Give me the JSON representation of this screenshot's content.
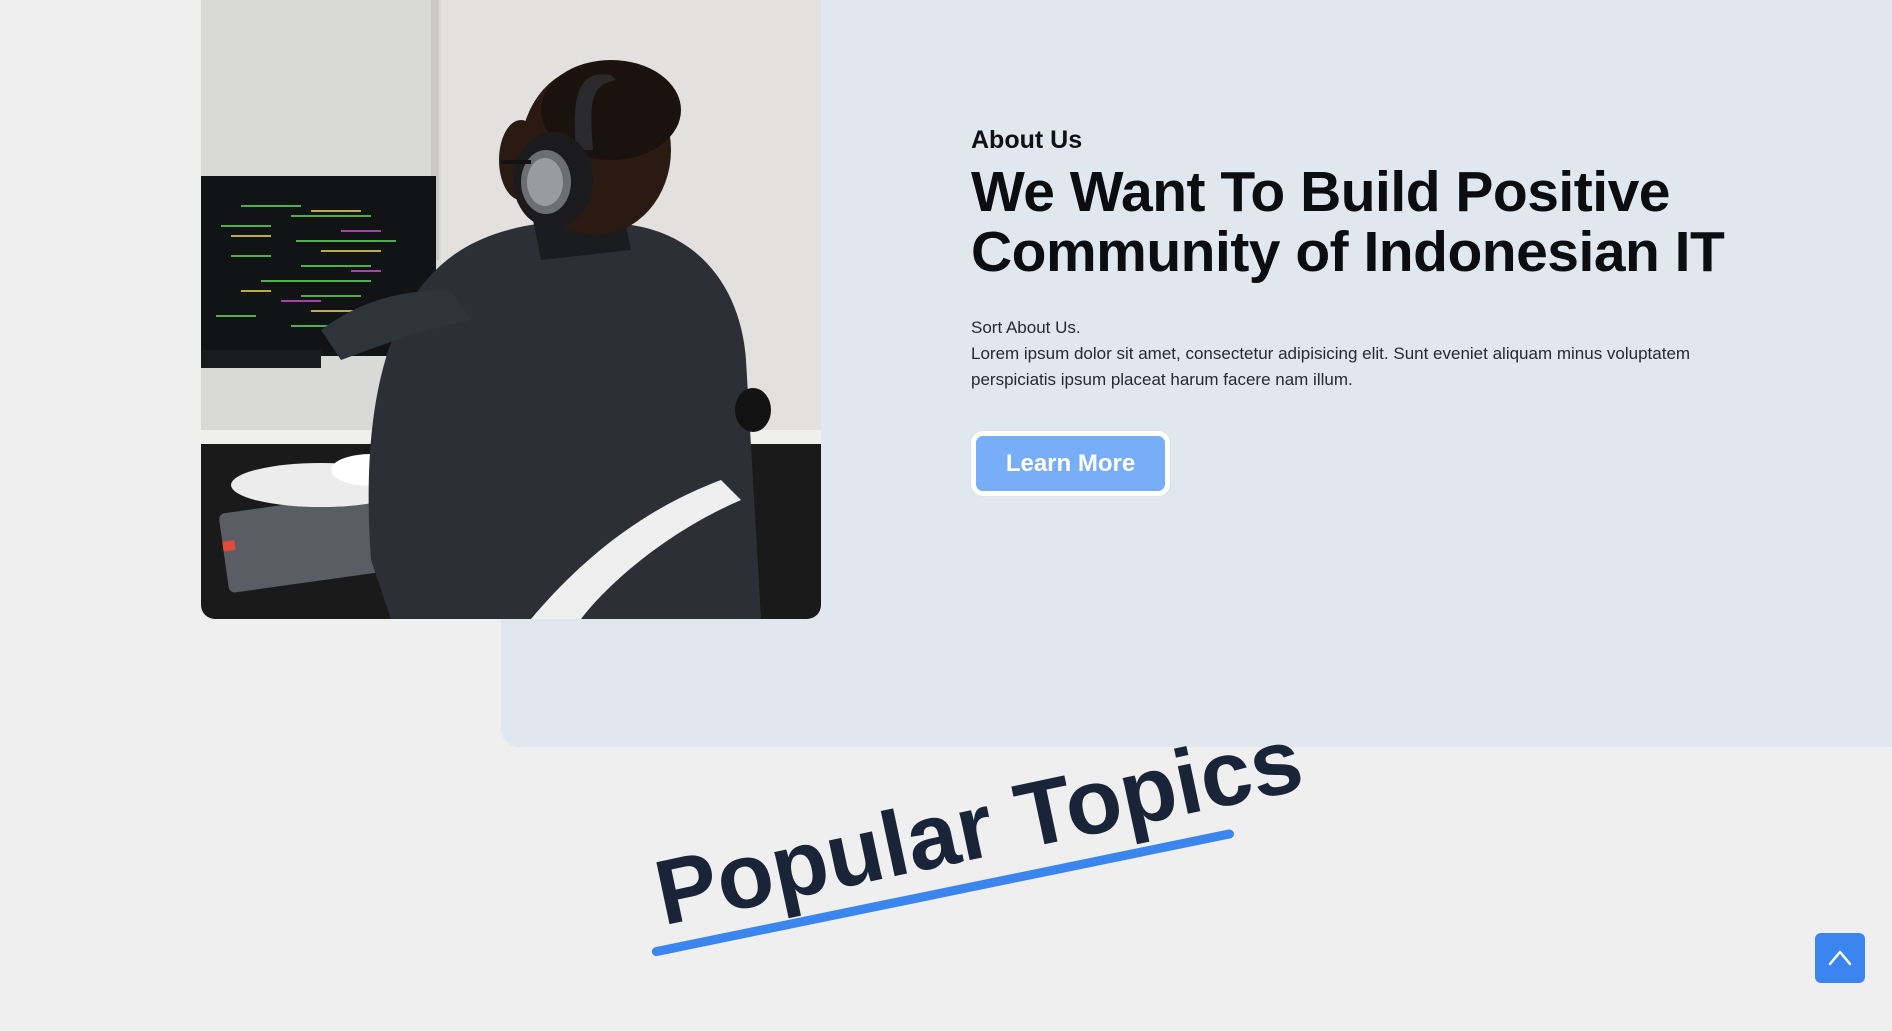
{
  "about": {
    "eyebrow": "About Us",
    "headline_line1": "We Want To Build Positive",
    "headline_line2": "Community of Indonesian IT",
    "desc_line1": "Sort About Us.",
    "desc_line2": "Lorem ipsum dolor sit amet, consectetur adipisicing elit. Sunt eveniet aliquam minus voluptatem",
    "desc_line3": "perspiciatis ipsum placeat harum facere nam illum.",
    "button_label": "Learn More"
  },
  "topics": {
    "title": "Popular Topics"
  },
  "icons": {
    "scroll_top": "chevron-up-icon"
  },
  "colors": {
    "page_bg": "#efefef",
    "panel_bg": "#e1e7ef",
    "button_bg": "#78adf7",
    "accent": "#3a86ee",
    "heading": "#1a2438"
  }
}
